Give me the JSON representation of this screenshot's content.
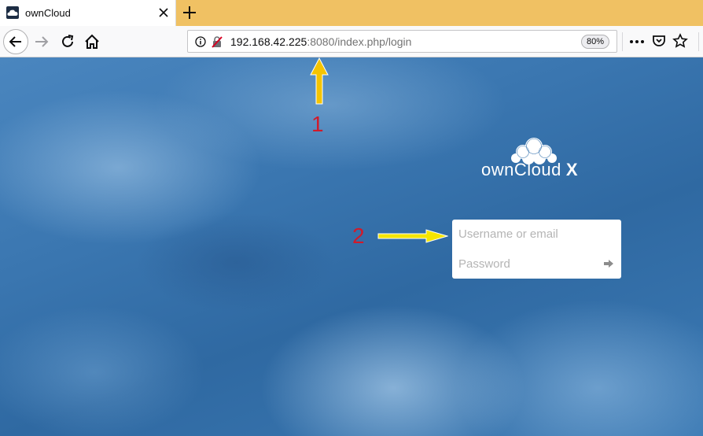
{
  "browser": {
    "tab_title": "ownCloud",
    "url_host": "192.168.42.225",
    "url_rest": ":8080/index.php/login",
    "zoom": "80%"
  },
  "logo": {
    "text": "ownCloud",
    "mark": "X"
  },
  "login": {
    "username_placeholder": "Username or email",
    "password_placeholder": "Password"
  },
  "annotations": {
    "label_1": "1",
    "label_2": "2"
  },
  "colors": {
    "tabstrip": "#f0c163",
    "annotation_number": "#d11a2a",
    "annotation_arrow": "#f5c400"
  },
  "icons": [
    "owncloud-favicon-icon",
    "close-icon",
    "plus-icon",
    "back-arrow-icon",
    "forward-arrow-icon",
    "reload-icon",
    "home-icon",
    "info-icon",
    "insecure-lock-icon",
    "more-icon",
    "pocket-icon",
    "star-icon",
    "submit-arrow-icon",
    "up-arrow-icon",
    "right-arrow-icon"
  ]
}
